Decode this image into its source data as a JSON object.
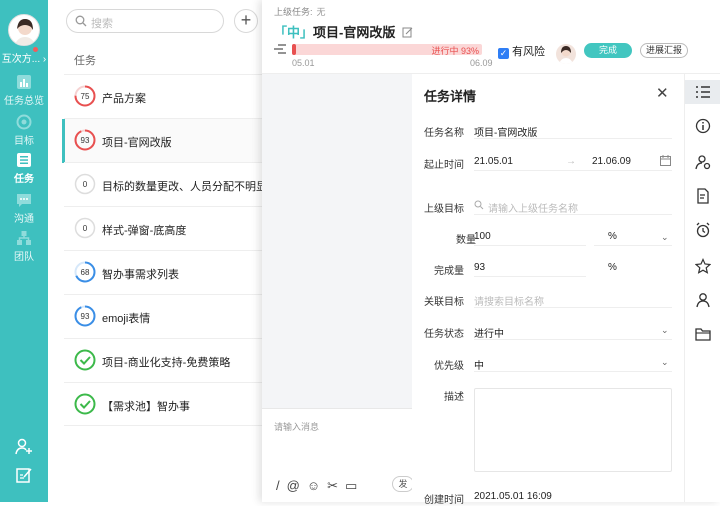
{
  "nav": {
    "user_name": "互次方...",
    "items": [
      {
        "label": "任务总览",
        "icon": "overview-icon"
      },
      {
        "label": "目标",
        "icon": "target-icon"
      },
      {
        "label": "任务",
        "icon": "task-list-icon"
      },
      {
        "label": "沟通",
        "icon": "chat-icon"
      },
      {
        "label": "团队",
        "icon": "team-icon"
      }
    ],
    "bottom_icons": [
      "add-member-icon",
      "edit-icon"
    ]
  },
  "list": {
    "search_placeholder": "搜索",
    "header": "任务",
    "rows": [
      {
        "label": "产品方案",
        "badge": "75",
        "status": "red"
      },
      {
        "label": "项目-官网改版",
        "badge": "93",
        "status": "red"
      },
      {
        "label": "目标的数量更改、人员分配不明显",
        "badge": "0",
        "status": "none"
      },
      {
        "label": "样式-弹窗-底高度",
        "badge": "0",
        "status": "none"
      },
      {
        "label": "智办事需求列表",
        "badge": "68",
        "status": "blue"
      },
      {
        "label": "emoji表情",
        "badge": "93",
        "status": "blue"
      },
      {
        "label": "项目-商业化支持-免费策略",
        "badge": "",
        "status": "done"
      },
      {
        "label": "【需求池】智办事",
        "badge": "",
        "status": "done"
      }
    ]
  },
  "task": {
    "parent_label": "上级任务:",
    "parent_value": "无",
    "priority_mark": "「中」",
    "title": "项目-官网改版",
    "progress_text": "进行中  93%",
    "progress_fraction": 0.93,
    "start_date": "05.01",
    "end_date": "06.09",
    "risk_label": "有风险",
    "done_button": "完成",
    "report_button": "进展汇报"
  },
  "chat": {
    "input_placeholder": "请输入消息",
    "send_label": "发"
  },
  "detail": {
    "heading": "任务详情",
    "name_label": "任务名称",
    "name_value": "项目-官网改版",
    "period_label": "起止时间",
    "start": "21.05.01",
    "arrow": "→",
    "end": "21.06.09",
    "goal_label": "上级目标",
    "goal_placeholder": "请输入上级任务名称",
    "qty_label": "数量",
    "qty_value": "100",
    "qty_unit": "%",
    "done_label": "完成量",
    "done_value": "93",
    "done_unit": "%",
    "related_label": "关联目标",
    "related_placeholder": "请搜索目标名称",
    "status_label": "任务状态",
    "status_value": "进行中",
    "priority_label": "优先级",
    "priority_value": "中",
    "desc_label": "描述",
    "created_label": "创建时间",
    "created_value": "2021.05.01 16:09"
  },
  "side_icons": [
    "list-icon",
    "info-icon",
    "member-settings-icon",
    "document-icon",
    "alarm-icon",
    "star-icon",
    "person-icon",
    "folder-icon"
  ],
  "colors": {
    "accent": "#3ec0bf",
    "danger": "#e85050",
    "progress_blue": "#3a8ee6",
    "done_green": "#3cb94a"
  }
}
